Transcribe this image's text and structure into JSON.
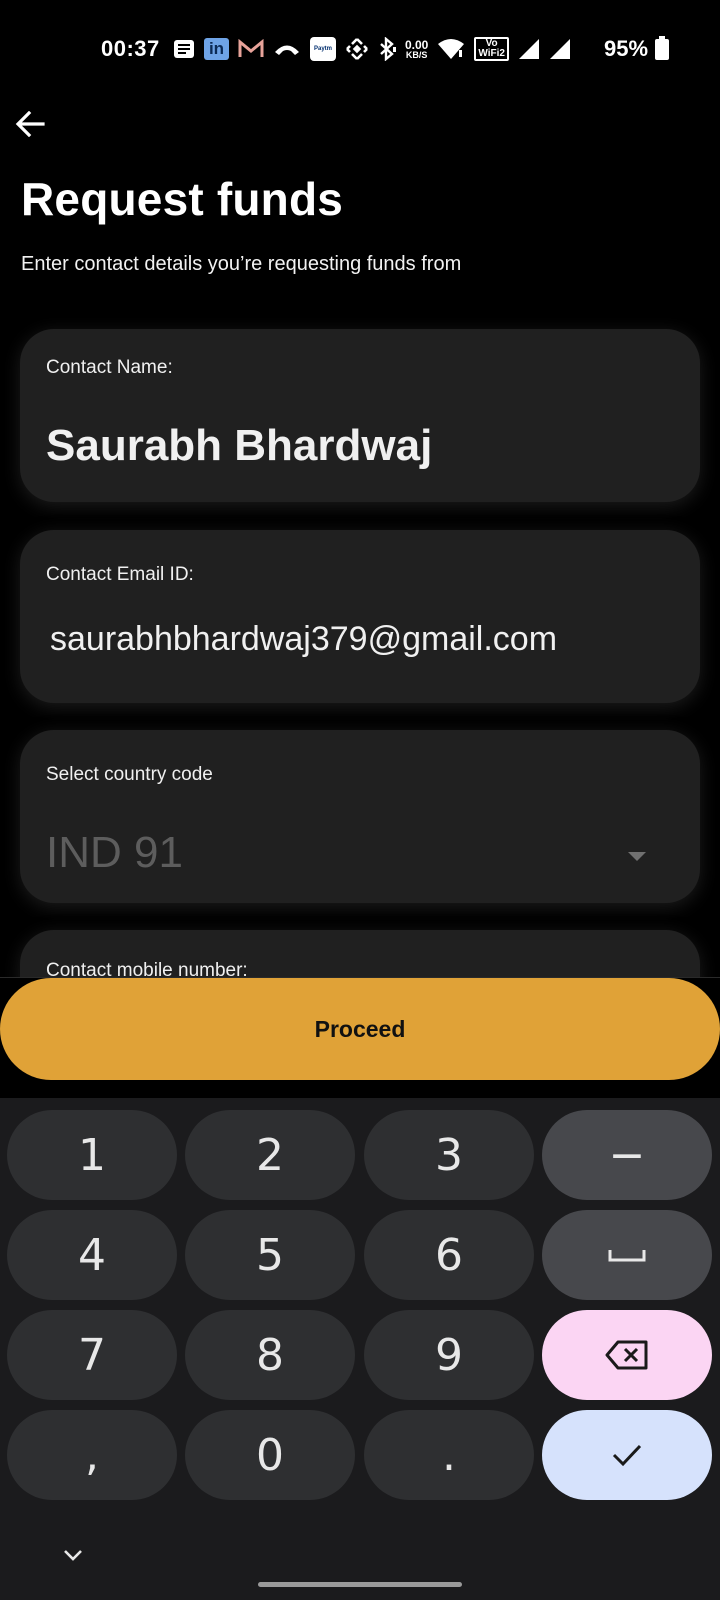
{
  "status_bar": {
    "time": "00:37",
    "net_speed_value": "0.00",
    "net_speed_unit": "KB/S",
    "vowifi_top": "Vo",
    "vowifi_bottom": "WiFi2",
    "battery": "95%",
    "icons": [
      "notes-icon",
      "linkedin-icon",
      "gmail-icon",
      "call-icon",
      "paytm-icon",
      "binance-icon",
      "bluetooth-icon",
      "net-speed-icon",
      "wifi-icon",
      "vowifi-icon",
      "signal-icon",
      "signal-icon-2",
      "battery-icon"
    ],
    "paytm_label": "Paytm",
    "linkedin_label": "in"
  },
  "header": {
    "title": "Request funds",
    "subtitle": "Enter contact details you’re requesting funds from"
  },
  "form": {
    "name_label": "Contact Name:",
    "name_value": "Saurabh Bhardwaj",
    "email_label": "Contact Email ID:",
    "email_value": "saurabhbhardwaj379@gmail.com",
    "country_label": "Select country code",
    "country_value": "IND 91",
    "mobile_label": "Contact mobile number:"
  },
  "actions": {
    "proceed_label": "Proceed"
  },
  "keyboard": {
    "rows": [
      [
        "1",
        "2",
        "3",
        "−"
      ],
      [
        "4",
        "5",
        "6",
        "␣"
      ],
      [
        "7",
        "8",
        "9",
        "⌫"
      ],
      [
        ",",
        "0",
        ".",
        "✓"
      ]
    ]
  },
  "colors": {
    "accent": "#e0a237",
    "card": "#202020",
    "background": "#000000",
    "key": "#2e2f31",
    "key_func": "#47484c",
    "key_backspace": "#fbd5f3",
    "key_enter": "#d6e2fc"
  }
}
